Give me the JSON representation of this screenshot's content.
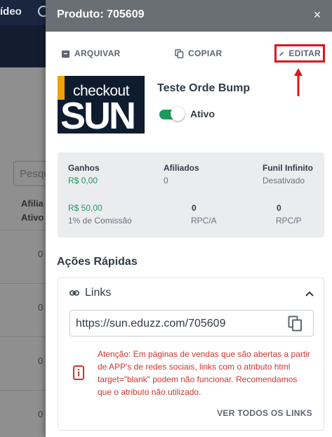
{
  "background": {
    "topbar_text": "ídeo",
    "search_placeholder": "Pesquisar",
    "column_header_line1": "Afilia",
    "column_header_line2": "Ativo",
    "row_values": [
      "0",
      "0",
      "0",
      "0"
    ]
  },
  "drawer": {
    "title": "Produto: 705609",
    "close_label": "×",
    "actions": {
      "archive": "ARQUIVAR",
      "copy": "COPIAR",
      "edit": "EDITAR"
    },
    "logo": {
      "small": "checkout",
      "big": "SUN"
    },
    "product_name": "Teste Orde Bump",
    "status": {
      "label": "Ativo",
      "enabled": true
    },
    "stats": {
      "earnings_label": "Ganhos",
      "earnings_value": "R$ 0,00",
      "affiliates_label": "Afiliados",
      "affiliates_value": "0",
      "funnel_label": "Funil Infinito",
      "funnel_value": "Desativado",
      "commission_value": "R$ 50,00",
      "commission_label": "1% de Comissão",
      "rpca_value": "0",
      "rpca_label": "RPC/A",
      "rpcp_value": "0",
      "rpcp_label": "RPC/P"
    },
    "quick_actions_title": "Ações Rápidas",
    "links": {
      "title": "Links",
      "url": "https://sun.eduzz.com/705609",
      "warning": "Atenção: Em páginas de vendas que são abertas a partir de APP's de redes sociais, links com o atributo html target=\"blank\" podem não funcionar. Recomendamos que o atributo não utilizado.",
      "see_all": "VER TODOS OS LINKS"
    }
  },
  "colors": {
    "header_bg": "#6a6e75",
    "accent_green": "#1e9a5b",
    "highlight_red": "#e0141a",
    "warning_red": "#d0352e",
    "stats_bg": "#ebecee"
  }
}
